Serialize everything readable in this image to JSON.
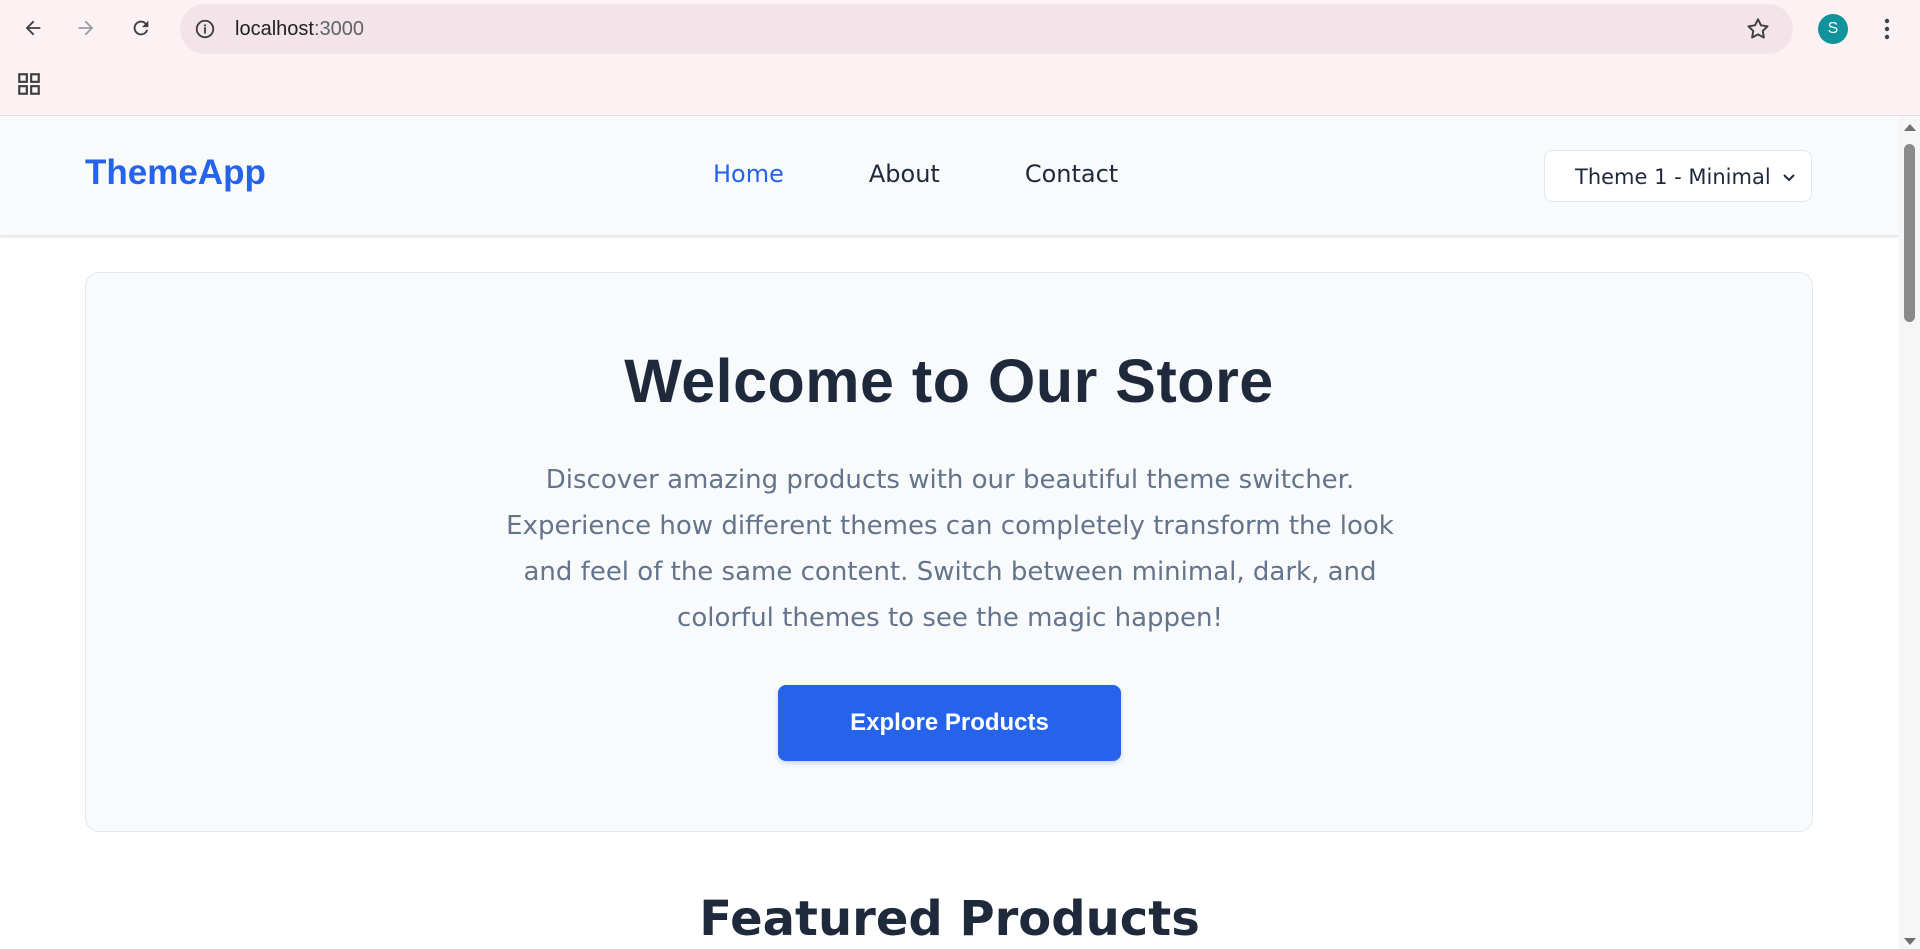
{
  "browser": {
    "url_host": "localhost",
    "url_port": ":3000",
    "profile_initial": "S"
  },
  "site": {
    "logo": "ThemeApp",
    "nav": [
      {
        "label": "Home",
        "active": true
      },
      {
        "label": "About",
        "active": false
      },
      {
        "label": "Contact",
        "active": false
      }
    ],
    "theme_select": {
      "selected": "Theme 1 - Minimal"
    }
  },
  "hero": {
    "title": "Welcome to Our Store",
    "description": "Discover amazing products with our beautiful theme switcher. Experience how different themes can completely transform the look and feel of the same content. Switch between minimal, dark, and colorful themes to see the magic happen!",
    "cta_label": "Explore Products"
  },
  "featured": {
    "title": "Featured Products"
  },
  "colors": {
    "accent": "#2563eb",
    "text_dark": "#1e293b",
    "text_muted": "#64748b",
    "surface": "#f8fafc"
  }
}
